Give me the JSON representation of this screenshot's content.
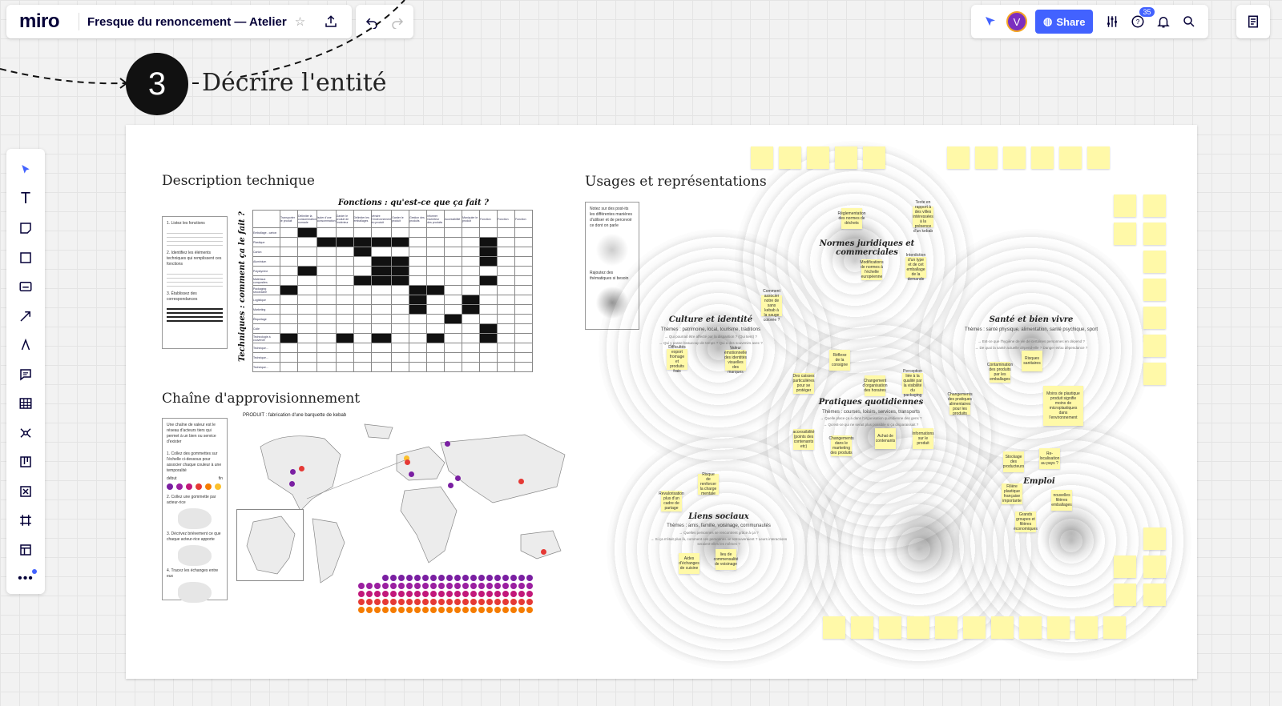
{
  "app": {
    "logo": "miro",
    "board_title": "Fresque du renoncement — Atelier",
    "share_label": "Share",
    "avatar_initial": "V",
    "notifications_count": "35",
    "accent_color": "#4262ff"
  },
  "step": {
    "number": "3",
    "title": "Décrire l'entité"
  },
  "sections": {
    "description": "Description technique",
    "supply": "Chaîne d'approvisionnement",
    "usages": "Usages et représentations"
  },
  "description_card": {
    "step1": "1. Listez les fonctions",
    "step2": "2. Identifiez les éléments techniques qui remplissent ces fonctions",
    "step3": "3. Établissez des correspondances"
  },
  "matrix": {
    "title": "Fonctions : qu'est-ce que ça fait ?",
    "vertical_label": "Techniques : comment ça le fait ?",
    "columns": [
      "Transporter le produit",
      "Délimiter la consommation nomade",
      "Isoler d'une consommation",
      "Garder le produit de l'extérieur",
      "Délimiter les emballages",
      "Vendre l'environnement du produit",
      "Garder le produit",
      "Gestion des produits",
      "Informer l'acheteur des produits",
      "Accessibilité",
      "Manipuler le produit",
      "Fonction",
      "Fonction",
      "Fonction"
    ],
    "rows": [
      "Emballage - carton",
      "Plastique",
      "Carton",
      "Aluminium",
      "Polystyrène",
      "Matériaux composites",
      "Packaging secondaire",
      "Logistique",
      "Marketing",
      "Étiquetage",
      "Colle",
      "Technologie à couvercle",
      "Technique...",
      "Technique...",
      "Technique..."
    ]
  },
  "supply_card": {
    "intro": "Une chaîne de valeur est le réseau d'acteurs tiers qui permet à un bien ou service d'exister",
    "step1": "1. Collez des gommettes sur l'échelle ci-dessous pour associer chaque couleur à une temporalité",
    "scale_left": "début",
    "scale_right": "fin",
    "step2": "2. Collez une gommette par acteur-rice",
    "step3": "3. Décrivez brièvement ce que chaque acteur-rice apporte",
    "step4": "4. Tracez les échanges entre eux"
  },
  "map": {
    "product_label": "PRODUIT : fabrication d'une barquette de kebab"
  },
  "usages_card": {
    "intro": "Notez sur des post-its les différentes manières d'utiliser et de percevoir ce dont on parle",
    "step2": "Rajoutez des thématiques si besoin"
  },
  "themes": [
    {
      "title": "Normes juridiques et commerciales",
      "sub": "",
      "q1": "",
      "q2": ""
    },
    {
      "title": "Culture et identité",
      "sub": "Thèmes : patrimoine, local, tourisme, traditions",
      "q1": "→ Qui pourrait être affecté par la disparition ? (Qui tient) ?",
      "q2": "→ Qui y passe beaucoup de temps ? Qui a des souvenirs avec ?"
    },
    {
      "title": "Santé et bien vivre",
      "sub": "Thèmes : santé physique, alimentation, santé psychique, sport",
      "q1": "→ Est-ce que l'hygiène de vie de certaines personnes en dépend ?",
      "q2": "→ De quoi la santé actuelle dépend-elle ? Danger et/ou dépendance ?"
    },
    {
      "title": "Pratiques quotidiennes",
      "sub": "Thèmes : courses, loisirs, services, transports",
      "q1": "→ Quelle place ça a dans l'organisation quotidienne des gens ?",
      "q2": "→ Qu'est-ce qui ne serait plus possible si ça disparaissait ?"
    },
    {
      "title": "Emploi",
      "sub": "",
      "q1": "",
      "q2": ""
    },
    {
      "title": "Liens sociaux",
      "sub": "Thèmes : amis, famille, voisinage, communautés",
      "q1": "→ Quelles personnes se rencontrent grâce à ça ?",
      "q2": "→ Si ça n'était plus là, comment ces personnes se retrouveraient ? Leurs interactions seraient-elles les mêmes ?"
    }
  ],
  "stickies": {
    "n1": "Réglementation des normes de déchets",
    "n2": "Texte en rapport à des villes intéressées à la présence d'un kebab",
    "n3": "Modifications de normes à l'échelle européenne",
    "n4": "Interdiction d'un type et de cet emballage de la demande",
    "c1": "Comment associer notre de sans kebab à la sauge colorée ?",
    "c2": "Difficultés export fromage et produits frais",
    "c3": "Valeur émotionnelle des identités visuelles des marques",
    "p1": "Réflexe de la consigne",
    "p2": "Changement d'organisation des horaires",
    "p3": "Perception liée à la qualité par la visibilité du packaging",
    "p4": "Des caisses particulières pour se protéger",
    "p5": "accessibilité (points des contenants etc)",
    "p6": "Changements dans le marketing des produits",
    "p7": "Achat de contenants",
    "p8": "Informations sur le produit",
    "p9": "Changements des pratiques alimentaires pour les produits",
    "s1": "Contamination des produits par les emballages",
    "s2": "Risques sanitaires",
    "s3": "Moins de plastique produit signifie moins de microplastiques dans l'environnement",
    "e1": "Stockage des producteurs",
    "e2": "Re-localisation au pays ?",
    "e3": "Filière plastique française importante",
    "e4": "nouvelles filières emballages",
    "e5": "Grands groupes et filières économiques",
    "l1": "Revalorisation plus d'un cadre de partage",
    "l2": "Risque de renforcer la charge mentale",
    "l3": "Aides d'échanges de cuisine",
    "l4": "lieu de commensalité de voisinage"
  }
}
